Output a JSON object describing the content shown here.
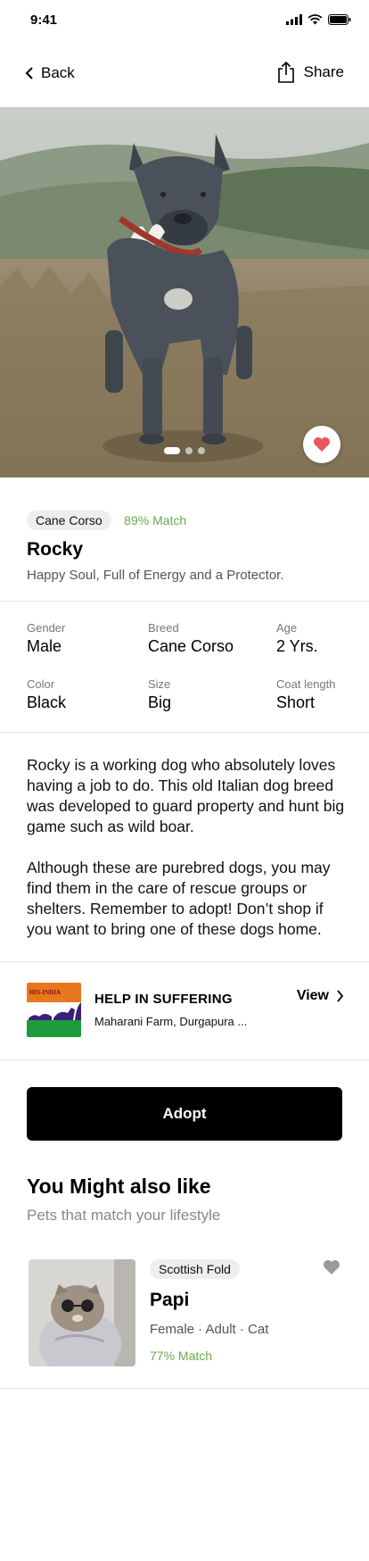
{
  "status": {
    "time": "9:41"
  },
  "nav": {
    "back_label": "Back",
    "share_label": "Share"
  },
  "hero": {
    "slide_count": 3,
    "active_slide": 1,
    "favorite_color": "#e8585a"
  },
  "pet": {
    "breed_chip": "Cane Corso",
    "match": "89% Match",
    "name": "Rocky",
    "tagline": "Happy Soul, Full of Energy and a Protector."
  },
  "attributes": [
    {
      "label": "Gender",
      "value": "Male"
    },
    {
      "label": "Breed",
      "value": "Cane Corso"
    },
    {
      "label": "Age",
      "value": "2 Yrs."
    },
    {
      "label": "Color",
      "value": "Black"
    },
    {
      "label": "Size",
      "value": "Big"
    },
    {
      "label": "Coat length",
      "value": "Short"
    }
  ],
  "description": {
    "p1": "Rocky is a working dog who absolutely loves having a job to do. This old Italian dog breed was developed to guard property and hunt big game such as wild boar.",
    "p2": "Although these are purebred dogs, you may find them in the care of rescue groups or shelters. Remember to adopt! Don’t shop if you want to bring one of these dogs home."
  },
  "shelter": {
    "logo_text": "HIS-INDIA",
    "name": "HELP IN SUFFERING",
    "address": "Maharani Farm, Durgapura ...",
    "view_label": "View"
  },
  "adopt_label": "Adopt",
  "recommendations": {
    "title": "You Might also like",
    "subtitle": "Pets that match your lifestyle",
    "items": [
      {
        "breed_chip": "Scottish Fold",
        "name": "Papi",
        "meta": "Female · Adult · Cat",
        "match": "77% Match"
      }
    ]
  },
  "colors": {
    "accent_green": "#6aa84f",
    "heart_red": "#e8585a",
    "button_black": "#000000"
  }
}
